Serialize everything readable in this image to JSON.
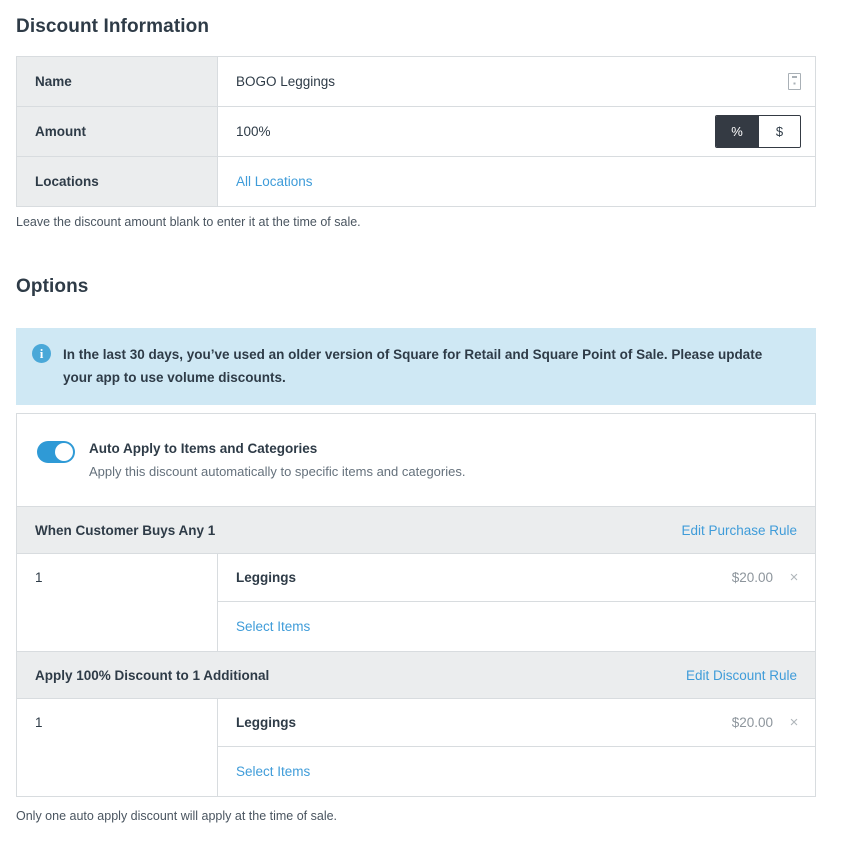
{
  "discount_information": {
    "heading": "Discount Information",
    "rows": [
      {
        "label": "Name",
        "value": "BOGO Leggings",
        "icon": "label-tag-icon"
      },
      {
        "label": "Amount",
        "value": "100%"
      },
      {
        "label": "Locations",
        "value": "All Locations"
      }
    ],
    "amount_unit_toggle": {
      "percent_label": "%",
      "dollar_label": "$",
      "selected": "%"
    },
    "caption": "Leave the discount amount blank to enter it at the time of sale."
  },
  "options": {
    "heading": "Options",
    "banner": {
      "icon": "info-circle-icon",
      "text": "In the last 30 days, you’ve used an older version of Square for Retail and Square Point of Sale. Please update your app to use volume discounts."
    },
    "auto_apply": {
      "title": "Auto Apply to Items and Categories",
      "subtitle": "Apply this discount automatically to specific items and categories.",
      "enabled": true
    },
    "purchase_rule": {
      "header_title": "When Customer Buys Any 1",
      "header_action": "Edit Purchase Rule",
      "quantity": "1",
      "items": [
        {
          "name": "Leggings",
          "price": "$20.00",
          "remove": "×"
        }
      ],
      "select_items_label": "Select Items"
    },
    "discount_rule": {
      "header_title": "Apply 100% Discount to 1 Additional",
      "header_action": "Edit Discount Rule",
      "quantity": "1",
      "items": [
        {
          "name": "Leggings",
          "price": "$20.00",
          "remove": "×"
        }
      ],
      "select_items_label": "Select Items"
    },
    "caption": "Only one auto apply discount will apply at the time of sale."
  },
  "colors": {
    "link": "#3f9cd9",
    "toggle_on": "#2f9ad6",
    "banner_bg": "#cfe8f4",
    "header_row_bg": "#ebedee",
    "segment_active_bg": "#343a43",
    "text": "#2e3b47"
  }
}
